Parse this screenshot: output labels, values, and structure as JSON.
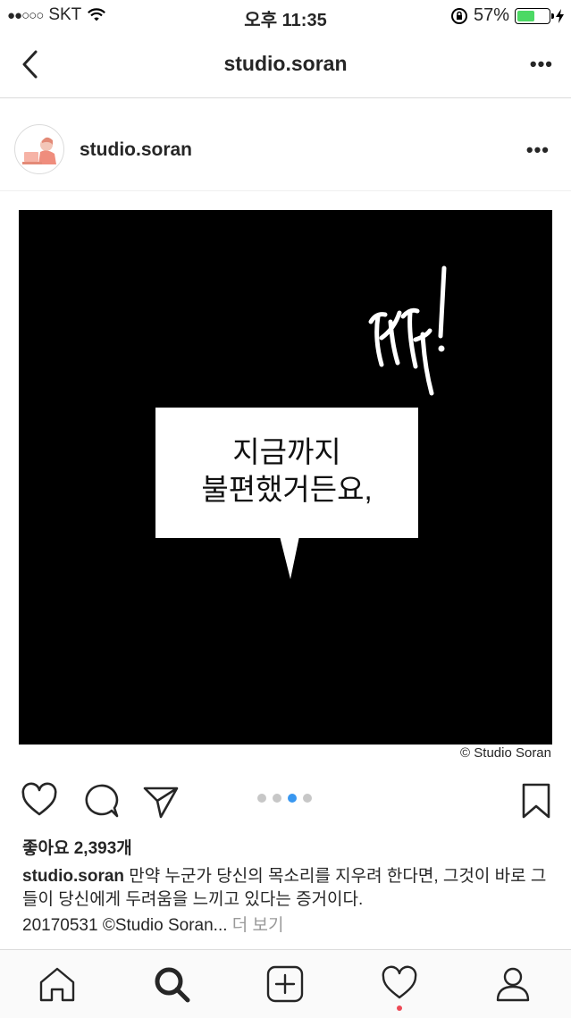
{
  "status_bar": {
    "signal": "●●○○○",
    "carrier": "SKT",
    "time": "오후 11:35",
    "battery": "57%",
    "battery_level": 0.57,
    "battery_color": "#4cd964"
  },
  "nav": {
    "title": "studio.soran",
    "back_icon": "chevron-left-icon",
    "more_icon": "more-horizontal-icon",
    "more_label": "•••"
  },
  "post": {
    "username": "studio.soran",
    "more_label": "•••",
    "image": {
      "background": "#000000",
      "speech_text_line1": "지금까지",
      "speech_text_line2": "불편했거든요,",
      "sfx_text": "딱!",
      "copyright": "© Studio Soran"
    },
    "carousel": {
      "count": 4,
      "active_index": 2,
      "active_color": "#3897f0"
    },
    "likes": "좋아요 2,393개",
    "caption_user": "studio.soran",
    "caption_text": " 만약 누군가 당신의 목소리를 지우려 한다면, 그것이 바로 그들이 당신에게 두려움을 느끼고 있다는 증거이다.",
    "caption_line2": "20170531 ©Studio Soran...",
    "more_link": " 더 보기"
  },
  "tabbar": {
    "items": [
      "home-icon",
      "search-icon",
      "add-post-icon",
      "activity-heart-icon",
      "profile-icon"
    ],
    "notif_color": "#ed4956"
  }
}
